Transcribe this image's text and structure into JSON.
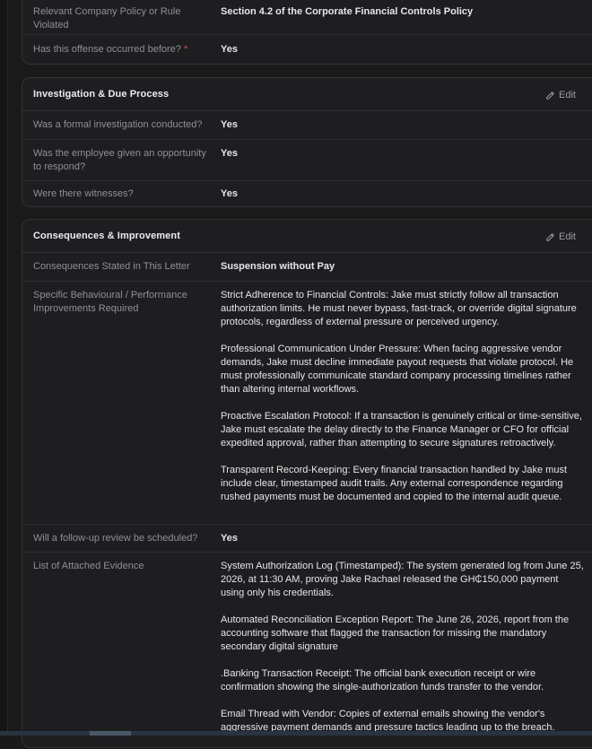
{
  "top_card": {
    "rows": [
      {
        "label": "Relevant Company Policy or Rule Violated",
        "value": "Section 4.2 of the Corporate Financial Controls Policy"
      },
      {
        "label": "Has this offense occurred before?",
        "required_mark": "*",
        "value": "Yes"
      }
    ]
  },
  "investigation": {
    "title": "Investigation & Due Process",
    "edit_label": "Edit",
    "rows": [
      {
        "label": "Was a formal investigation conducted?",
        "value": "Yes"
      },
      {
        "label": "Was the employee given an opportunity to respond?",
        "value": "Yes"
      },
      {
        "label": "Were there witnesses?",
        "value": "Yes"
      }
    ]
  },
  "consequences": {
    "title": "Consequences & Improvement",
    "edit_label": "Edit",
    "consequence_row": {
      "label": "Consequences Stated in This Letter",
      "value": "Suspension without Pay"
    },
    "improvements_row": {
      "label": "Specific Behavioural / Performance Improvements Required",
      "paragraphs": [
        "Strict Adherence to Financial Controls: Jake must strictly follow all transaction authorization limits. He must never bypass, fast-track, or override digital signature protocols, regardless of external pressure or perceived urgency.",
        "Professional Communication Under Pressure: When facing aggressive vendor demands, Jake must decline immediate payout requests that violate protocol. He must professionally communicate standard company processing timelines rather than altering internal workflows.",
        "Proactive Escalation Protocol: If a transaction is genuinely critical or time-sensitive, Jake must escalate the delay directly to the Finance Manager or CFO for official expedited approval, rather than attempting to secure signatures retroactively.",
        "Transparent Record-Keeping: Every financial transaction handled by Jake must include clear, timestamped audit trails. Any external correspondence regarding rushed payments must be documented and copied to the internal audit queue."
      ]
    },
    "followup_row": {
      "label": "Will a follow-up review be scheduled?",
      "value": "Yes"
    },
    "evidence_row": {
      "label": "List of Attached Evidence",
      "paragraphs": [
        "System Authorization Log (Timestamped): The system generated log from June 25, 2026, at 11:30 AM, proving Jake Rachael released the GH₵150,000 payment using only his credentials.",
        "Automated Reconciliation Exception Report: The June 26, 2026, report from the accounting software that flagged the transaction for missing the mandatory secondary digital signature",
        ".Banking Transaction Receipt: The official bank execution receipt or wire confirmation showing the single-authorization funds transfer to the vendor.",
        "Email Thread with Vendor: Copies of external emails showing the vendor's aggressive payment demands and pressure tactics leading up to the breach."
      ]
    }
  },
  "icons": {
    "edit": "pencil-icon"
  },
  "colors": {
    "background": "#1a1a1b",
    "card": "#1e1e20",
    "border": "#333336",
    "required": "#e5484d"
  }
}
